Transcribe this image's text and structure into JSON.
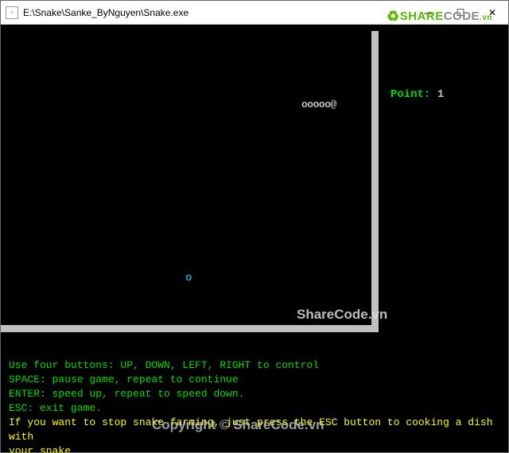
{
  "window": {
    "title": "E:\\Snake\\Sanke_ByNguyen\\Snake.exe",
    "icon_glyph": "▫",
    "controls": {
      "min": "—",
      "max": "☐",
      "close": "✕"
    }
  },
  "game": {
    "snake_body": "ooooo@",
    "food_char": "o",
    "score_label": "Point:",
    "score_value": "1"
  },
  "instructions": {
    "line1": "Use four buttons: UP, DOWN, LEFT, RIGHT to control",
    "line2": "SPACE: pause game, repeat to continue",
    "line3": "ENTER: speed up, repeat to speed down.",
    "line4": "ESC: exit game.",
    "line5": "If you want to stop snake farming, just press the ESC button to cooking a dish with",
    "line6": "your snake"
  },
  "watermarks": {
    "logo_recycle": "♻",
    "logo_share": "SHARE",
    "logo_code": "CODE",
    "logo_vn": ".vn",
    "mid": "ShareCode.vn",
    "copyright": "Copyright © ShareCode.vn"
  },
  "colors": {
    "bg": "#000000",
    "snake": "#c0c0c0",
    "food": "#00aacc",
    "wall": "#c0c0c0",
    "green": "#00dd00",
    "yellow": "#ffff00"
  }
}
